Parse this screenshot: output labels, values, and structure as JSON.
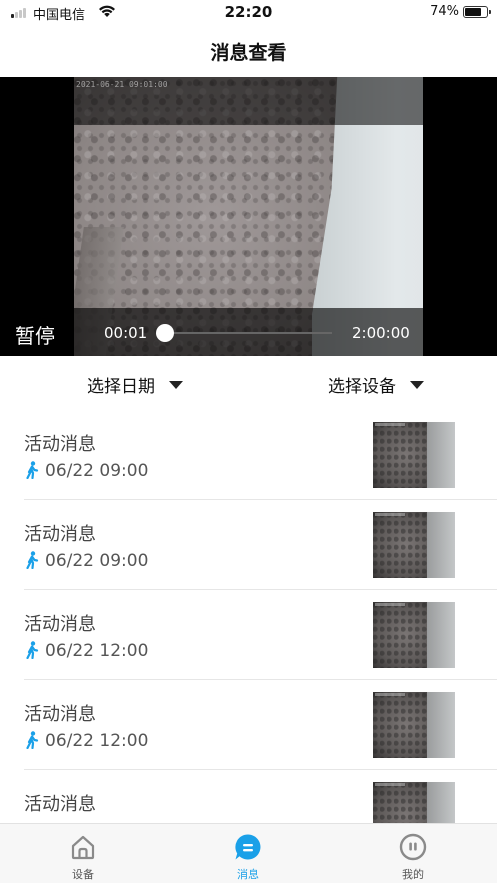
{
  "status_bar": {
    "carrier": "中国电信",
    "time": "22:20",
    "battery": "74%",
    "battery_level": 0.74
  },
  "header": {
    "title": "消息查看"
  },
  "video": {
    "timestamp": "2021-06-21 09:01:00",
    "pause_label": "暂停",
    "current_time": "00:01",
    "duration": "2:00:00",
    "progress": 0.0001
  },
  "filters": {
    "date_label": "选择日期",
    "device_label": "选择设备"
  },
  "messages": [
    {
      "title": "活动消息",
      "time": "06/22 09:00"
    },
    {
      "title": "活动消息",
      "time": "06/22 09:00"
    },
    {
      "title": "活动消息",
      "time": "06/22 12:00"
    },
    {
      "title": "活动消息",
      "time": "06/22 12:00"
    },
    {
      "title": "活动消息",
      "time": ""
    }
  ],
  "tab_bar": {
    "tabs": [
      {
        "label": "设备",
        "icon": "home-icon"
      },
      {
        "label": "消息",
        "icon": "message-icon"
      },
      {
        "label": "我的",
        "icon": "profile-icon"
      }
    ],
    "active": 1,
    "accent_color": "#1aa0e8"
  },
  "colors": {
    "accent": "#1aa0e8",
    "walking_icon": "#1aa0e8"
  }
}
